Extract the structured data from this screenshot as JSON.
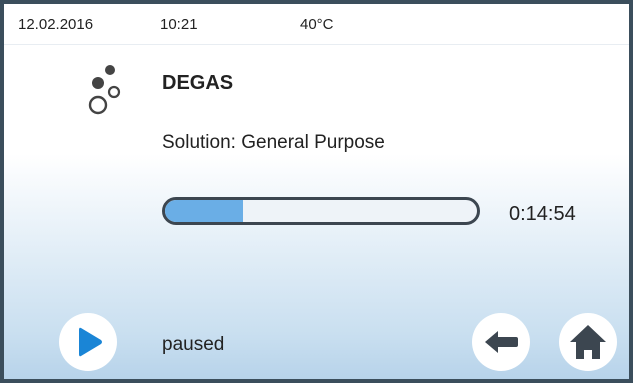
{
  "status_bar": {
    "date": "12.02.2016",
    "time": "10:21",
    "temperature": "40°C"
  },
  "program": {
    "icon": "bubbles-icon",
    "title": "DEGAS",
    "solution": "Solution: General Purpose"
  },
  "progress": {
    "fraction": 0.25,
    "remaining_time": "0:14:54"
  },
  "controls": {
    "play_icon": "play-icon",
    "state_label": "paused",
    "back_icon": "arrow-left-icon",
    "home_icon": "home-icon"
  },
  "colors": {
    "accent": "#1a85d6",
    "progress_fill": "#6aaee6",
    "dark": "#3c4650"
  }
}
